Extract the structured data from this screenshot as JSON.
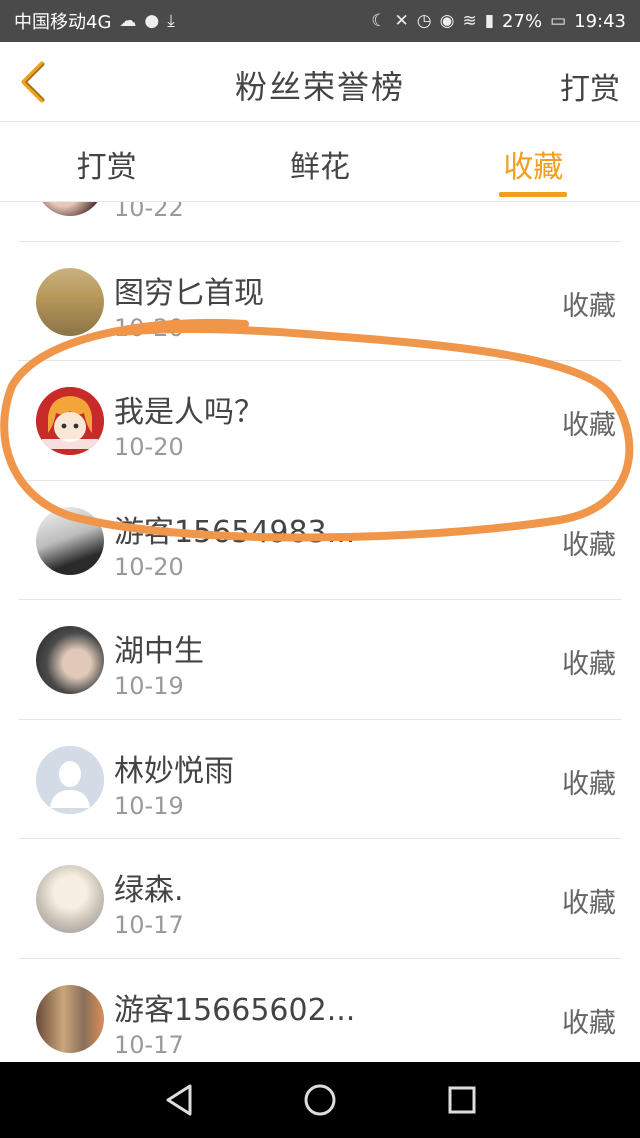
{
  "status_bar": {
    "carrier": "中国移动4G",
    "battery": "27%",
    "time": "19:43",
    "icons": [
      "weather-icon",
      "bulb-icon",
      "download-icon",
      "moon-icon",
      "mute-icon",
      "alarm-icon",
      "eye-icon",
      "wifi-icon",
      "signal-icon",
      "battery-icon"
    ]
  },
  "header": {
    "title": "粉丝荣誉榜",
    "action": "打赏",
    "back_icon": "chevron-left-icon"
  },
  "tabs": [
    {
      "label": "打赏",
      "active": false
    },
    {
      "label": "鲜花",
      "active": false
    },
    {
      "label": "收藏",
      "active": true
    }
  ],
  "list": [
    {
      "name": "",
      "date": "10-22",
      "action": ""
    },
    {
      "name": "图穷匕首现",
      "date": "10-20",
      "action": "收藏"
    },
    {
      "name": "我是人吗？",
      "date": "10-20",
      "action": "收藏"
    },
    {
      "name": "游客15654983...",
      "date": "10-20",
      "action": "收藏"
    },
    {
      "name": "湖中生",
      "date": "10-19",
      "action": "收藏"
    },
    {
      "name": "林妙悦雨",
      "date": "10-19",
      "action": "收藏"
    },
    {
      "name": "绿森.",
      "date": "10-17",
      "action": "收藏"
    },
    {
      "name": "游客15665602...",
      "date": "10-17",
      "action": "收藏"
    }
  ],
  "colors": {
    "accent": "#f0a01a",
    "highlight_stroke": "#f0964a"
  },
  "navbar": {
    "icons": [
      "back-triangle-icon",
      "home-circle-icon",
      "recents-square-icon"
    ]
  }
}
